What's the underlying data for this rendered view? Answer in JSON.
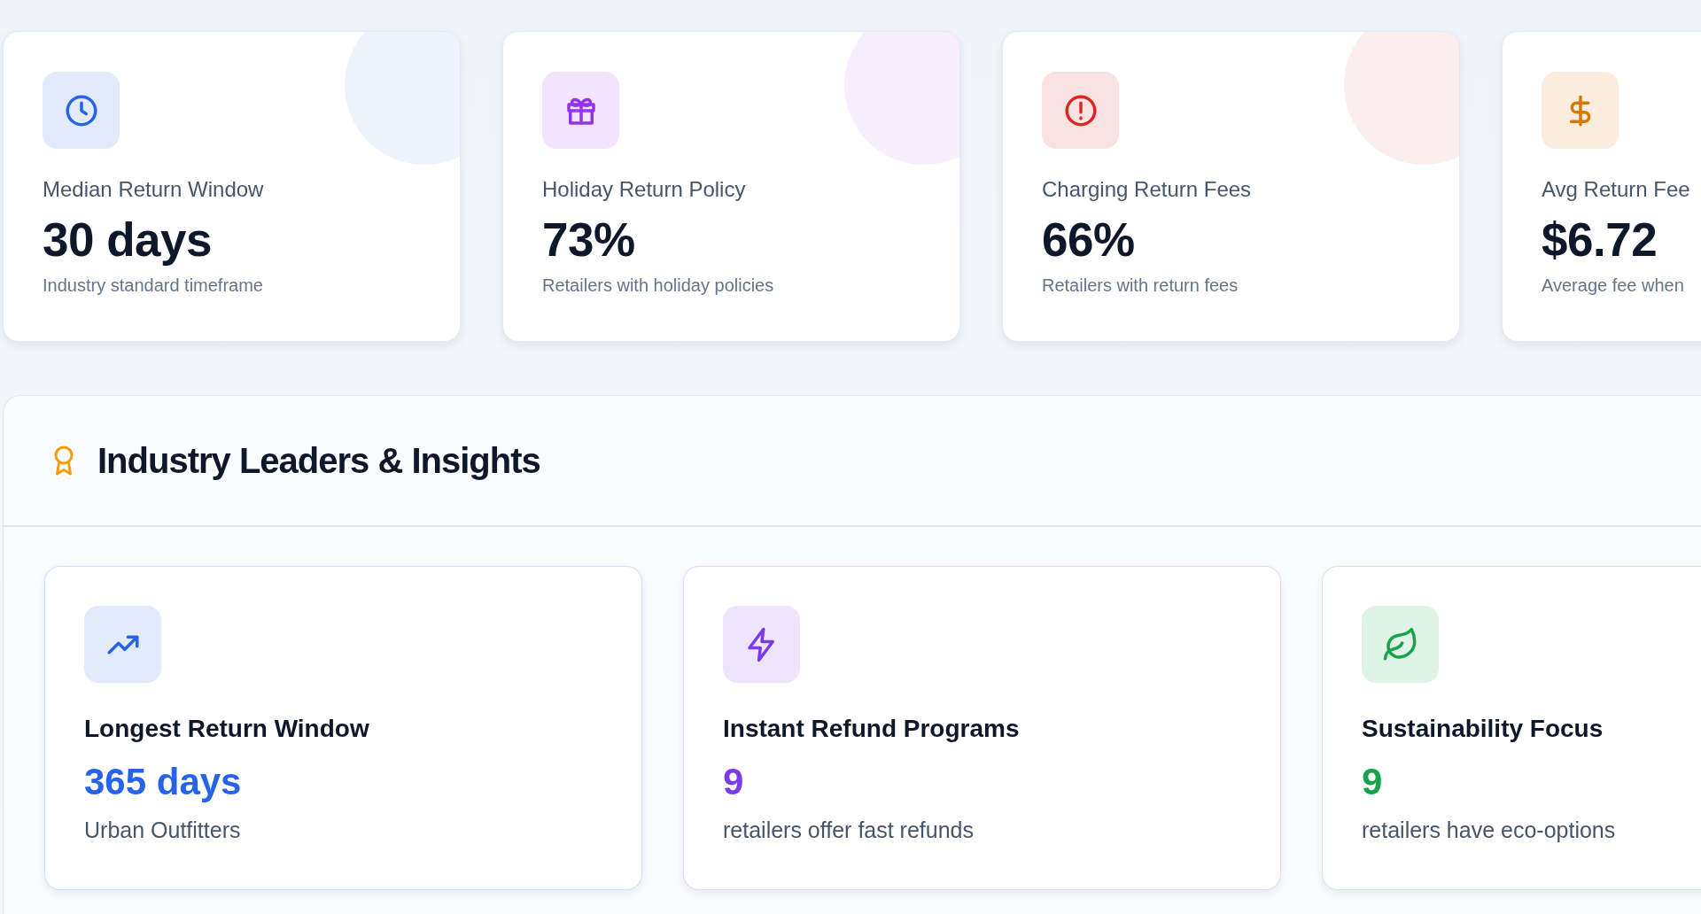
{
  "stats": [
    {
      "kind": "clock",
      "color": "#2563eb",
      "title": "Median Return Window",
      "value": "30 days",
      "note": "Industry standard timeframe"
    },
    {
      "kind": "gift",
      "color": "#9333ea",
      "title": "Holiday Return Policy",
      "value": "73%",
      "note": "Retailers with holiday policies"
    },
    {
      "kind": "alert",
      "color": "#dc2626",
      "title": "Charging Return Fees",
      "value": "66%",
      "note": "Retailers with return fees"
    },
    {
      "kind": "dollar",
      "color": "#d97706",
      "title": "Avg Return Fee",
      "value": "$6.72",
      "note": "Average fee when"
    }
  ],
  "insights": {
    "title": "Industry Leaders & Insights",
    "cards": [
      {
        "kind": "trend",
        "color": "#2563eb",
        "title": "Longest Return Window",
        "value": "365 days",
        "note": "Urban Outfitters"
      },
      {
        "kind": "bolt",
        "color": "#7c3aed",
        "title": "Instant Refund Programs",
        "value": "9",
        "note": "retailers offer fast refunds"
      },
      {
        "kind": "leaf",
        "color": "#16a34a",
        "title": "Sustainability Focus",
        "value": "9",
        "note": "retailers have eco-options"
      }
    ]
  }
}
